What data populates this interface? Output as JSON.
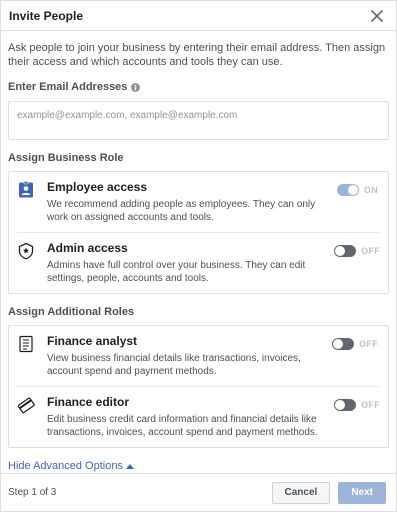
{
  "dialog": {
    "title": "Invite People",
    "intro": "Ask people to join your business by entering their email address. Then assign their access and which accounts and tools they can use."
  },
  "email": {
    "label": "Enter Email Addresses",
    "placeholder": "example@example.com, example@example.com",
    "value": ""
  },
  "business_role": {
    "label": "Assign Business Role",
    "options": [
      {
        "title": "Employee access",
        "description": "We recommend adding people as employees. They can only work on assigned accounts and tools.",
        "icon": "employee-badge-icon",
        "toggle_state": "ON"
      },
      {
        "title": "Admin access",
        "description": "Admins have full control over your business. They can edit settings, people, accounts and tools.",
        "icon": "admin-shield-icon",
        "toggle_state": "OFF"
      }
    ]
  },
  "additional_roles": {
    "label": "Assign Additional Roles",
    "options": [
      {
        "title": "Finance analyst",
        "description": "View business financial details like transactions, invoices, account spend and payment methods.",
        "icon": "ledger-icon",
        "toggle_state": "OFF"
      },
      {
        "title": "Finance editor",
        "description": "Edit business credit card information and financial details like transactions, invoices, account spend and payment methods.",
        "icon": "credit-card-icon",
        "toggle_state": "OFF"
      }
    ]
  },
  "advanced_link": "Hide Advanced Options",
  "footer": {
    "step": "Step 1 of 3",
    "cancel": "Cancel",
    "next": "Next"
  },
  "colors": {
    "link": "#4267b2",
    "toggle_on": "#9cb4d8",
    "toggle_off": "#606770",
    "next_disabled": "#9cb4d8"
  }
}
